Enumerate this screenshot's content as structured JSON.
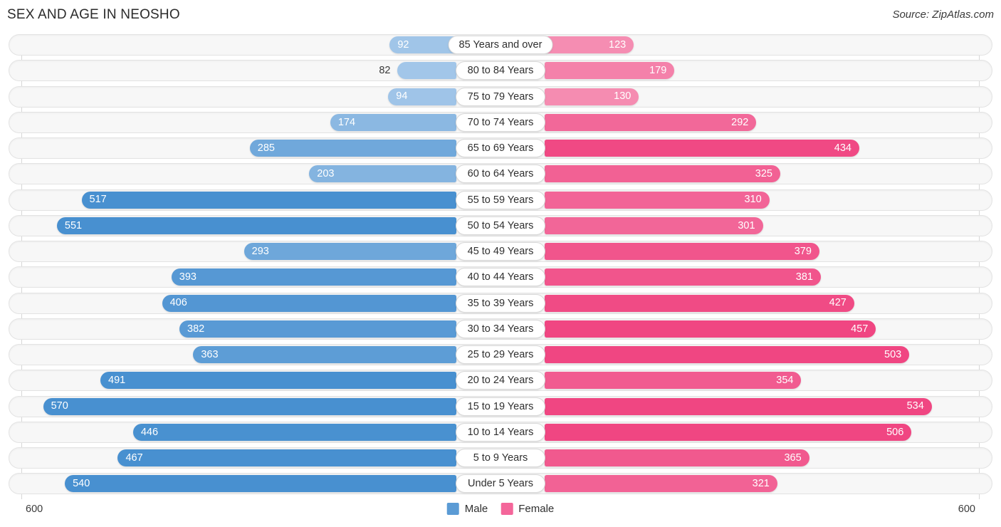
{
  "header": {
    "title": "SEX AND AGE IN NEOSHO",
    "source": "Source: ZipAtlas.com"
  },
  "legend": {
    "male_label": "Male",
    "female_label": "Female",
    "male_color": "#5b9bd5",
    "female_color": "#f4669a"
  },
  "axis": {
    "left_tick": "600",
    "right_tick": "600",
    "max": 600
  },
  "chart_data": {
    "type": "bar",
    "title": "SEX AND AGE IN NEOSHO",
    "subtitle": "Source: ZipAtlas.com",
    "xlabel": "",
    "ylabel": "",
    "orientation": "horizontal-diverging",
    "grid": false,
    "legend_position": "bottom-center",
    "xlim": [
      0,
      600
    ],
    "axis_ticks": [
      "600",
      "600"
    ],
    "categories": [
      "85 Years and over",
      "80 to 84 Years",
      "75 to 79 Years",
      "70 to 74 Years",
      "65 to 69 Years",
      "60 to 64 Years",
      "55 to 59 Years",
      "50 to 54 Years",
      "45 to 49 Years",
      "40 to 44 Years",
      "35 to 39 Years",
      "30 to 34 Years",
      "25 to 29 Years",
      "20 to 24 Years",
      "15 to 19 Years",
      "10 to 14 Years",
      "5 to 9 Years",
      "Under 5 Years"
    ],
    "series": [
      {
        "name": "Male",
        "color": "#5b9bd5",
        "values": [
          92,
          82,
          94,
          174,
          285,
          203,
          517,
          551,
          293,
          393,
          406,
          382,
          363,
          491,
          570,
          446,
          467,
          540
        ]
      },
      {
        "name": "Female",
        "color": "#f4669a",
        "values": [
          123,
          179,
          130,
          292,
          434,
          325,
          310,
          301,
          379,
          381,
          427,
          457,
          503,
          354,
          534,
          506,
          365,
          321
        ]
      }
    ]
  },
  "rows": [
    {
      "label": "85 Years and over",
      "male": 92,
      "female": 123
    },
    {
      "label": "80 to 84 Years",
      "male": 82,
      "female": 179
    },
    {
      "label": "75 to 79 Years",
      "male": 94,
      "female": 130
    },
    {
      "label": "70 to 74 Years",
      "male": 174,
      "female": 292
    },
    {
      "label": "65 to 69 Years",
      "male": 285,
      "female": 434
    },
    {
      "label": "60 to 64 Years",
      "male": 203,
      "female": 325
    },
    {
      "label": "55 to 59 Years",
      "male": 517,
      "female": 310
    },
    {
      "label": "50 to 54 Years",
      "male": 551,
      "female": 301
    },
    {
      "label": "45 to 49 Years",
      "male": 293,
      "female": 379
    },
    {
      "label": "40 to 44 Years",
      "male": 393,
      "female": 381
    },
    {
      "label": "35 to 39 Years",
      "male": 406,
      "female": 427
    },
    {
      "label": "30 to 34 Years",
      "male": 382,
      "female": 457
    },
    {
      "label": "25 to 29 Years",
      "male": 363,
      "female": 503
    },
    {
      "label": "20 to 24 Years",
      "male": 491,
      "female": 354
    },
    {
      "label": "15 to 19 Years",
      "male": 570,
      "female": 534
    },
    {
      "label": "10 to 14 Years",
      "male": 446,
      "female": 506
    },
    {
      "label": "5 to 9 Years",
      "male": 467,
      "female": 365
    },
    {
      "label": "Under 5 Years",
      "male": 540,
      "female": 321
    }
  ]
}
